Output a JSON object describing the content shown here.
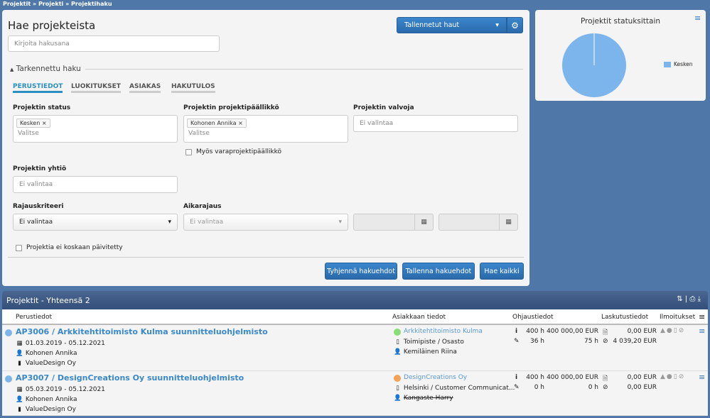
{
  "breadcrumb": [
    "Projektit",
    "Projekti",
    "Projektihaku"
  ],
  "search": {
    "title": "Hae projekteista",
    "placeholder": "Kirjoita hakusana",
    "saved_searches": "Tallennetut haut",
    "advanced": "Tarkennettu haku",
    "tabs": [
      "PERUSTIEDOT",
      "LUOKITUKSET",
      "ASIAKAS",
      "HAKUTULOS"
    ],
    "status_label": "Projektin status",
    "status_chip": "Kesken",
    "status_placeholder": "Valitse",
    "manager_label": "Projektin projektipäällikkö",
    "manager_chip": "Kohonen Annika",
    "manager_placeholder": "Valitse",
    "deputy_checkbox": "Myös varaprojektipäällikkö",
    "supervisor_label": "Projektin valvoja",
    "supervisor_value": "Ei valintaa",
    "company_label": "Projektin yhtiö",
    "company_value": "Ei valintaa",
    "criteria_label": "Rajauskriteeri",
    "criteria_value": "Ei valintaa",
    "time_label": "Aikarajaus",
    "time_value": "Ei valintaa",
    "never_updated": "Projektia ei koskaan päivitetty",
    "clear": "Tyhjennä hakuehdot",
    "save": "Tallenna hakuehdot",
    "search_all": "Hae kaikki"
  },
  "chart_data": {
    "type": "pie",
    "title": "Projektit statuksittain",
    "categories": [
      "Kesken"
    ],
    "values": [
      2
    ],
    "legend": "right",
    "colors": [
      "#7cb4ec"
    ]
  },
  "results": {
    "title": "Projektit - Yhteensä 2",
    "columns": [
      "Perustiedot",
      "Asiakkaan tiedot",
      "Ohjaustiedot",
      "Laskutustiedot",
      "Ilmoitukset"
    ],
    "rows": [
      {
        "name": "AP3006 / Arkkitehtitoimisto Kulma suunnitteluohjelmisto",
        "dates": "01.03.2019 - 05.12.2021",
        "manager": "Kohonen Annika",
        "company": "ValueDesign Oy",
        "customer": "Arkkitehtitoimisto Kulma",
        "customer_color": "#88dd77",
        "unit": "Toimipiste / Osasto",
        "contact": "Kemiläinen Riina",
        "contact_strike": false,
        "budget_h": "400 h",
        "budget_eur": "400 000,00 EUR",
        "used_h": "36 h",
        "other_h": "75 h",
        "invoiced": "0,00 EUR",
        "uninvoiced": "4 039,20 EUR"
      },
      {
        "name": "AP3007 / DesignCreations Oy suunnitteluohjelmisto",
        "dates": "05.03.2019 - 05.12.2021",
        "manager": "Kohonen Annika",
        "company": "ValueDesign Oy",
        "customer": "DesignCreations Oy",
        "customer_color": "#f4a25a",
        "unit": "Helsinki / Customer Communicat...",
        "contact": "Kangaste Harry",
        "contact_strike": true,
        "budget_h": "400 h",
        "budget_eur": "400 000,00 EUR",
        "used_h": "0 h",
        "other_h": "0 h",
        "invoiced": "0,00 EUR",
        "uninvoiced": "0,00 EUR"
      }
    ]
  }
}
